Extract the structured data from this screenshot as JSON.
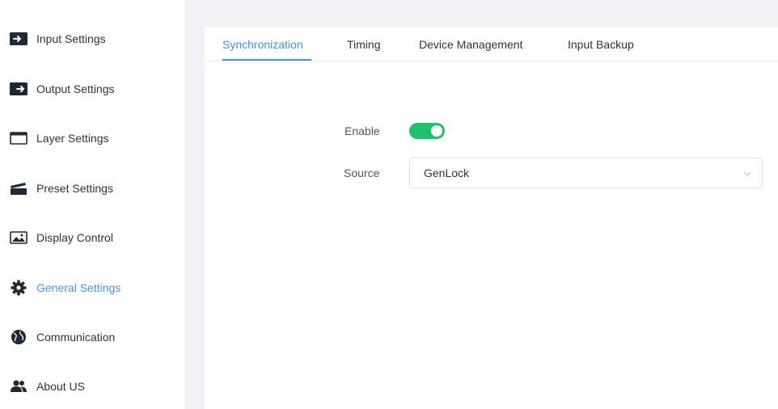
{
  "sidebar": {
    "items": [
      {
        "label": "Input Settings",
        "icon": "input-icon",
        "active": false
      },
      {
        "label": "Output Settings",
        "icon": "output-icon",
        "active": false
      },
      {
        "label": "Layer Settings",
        "icon": "window-icon",
        "active": false
      },
      {
        "label": "Preset Settings",
        "icon": "clapperboard-icon",
        "active": false
      },
      {
        "label": "Display Control",
        "icon": "image-icon",
        "active": false
      },
      {
        "label": "General Settings",
        "icon": "gear-icon",
        "active": true
      },
      {
        "label": "Communication",
        "icon": "globe-icon",
        "active": false
      },
      {
        "label": "About US",
        "icon": "users-icon",
        "active": false
      }
    ]
  },
  "tabs": [
    {
      "label": "Synchronization",
      "active": true
    },
    {
      "label": "Timing",
      "active": false
    },
    {
      "label": "Device Management",
      "active": false
    },
    {
      "label": "Input Backup",
      "active": false
    }
  ],
  "form": {
    "enable_label": "Enable",
    "enable_value": true,
    "source_label": "Source",
    "source_value": "GenLock"
  },
  "colors": {
    "accent": "#4a90e2",
    "toggle_on": "#1fc16b",
    "icon": "#1f2a37",
    "background": "#f0f2f5"
  }
}
